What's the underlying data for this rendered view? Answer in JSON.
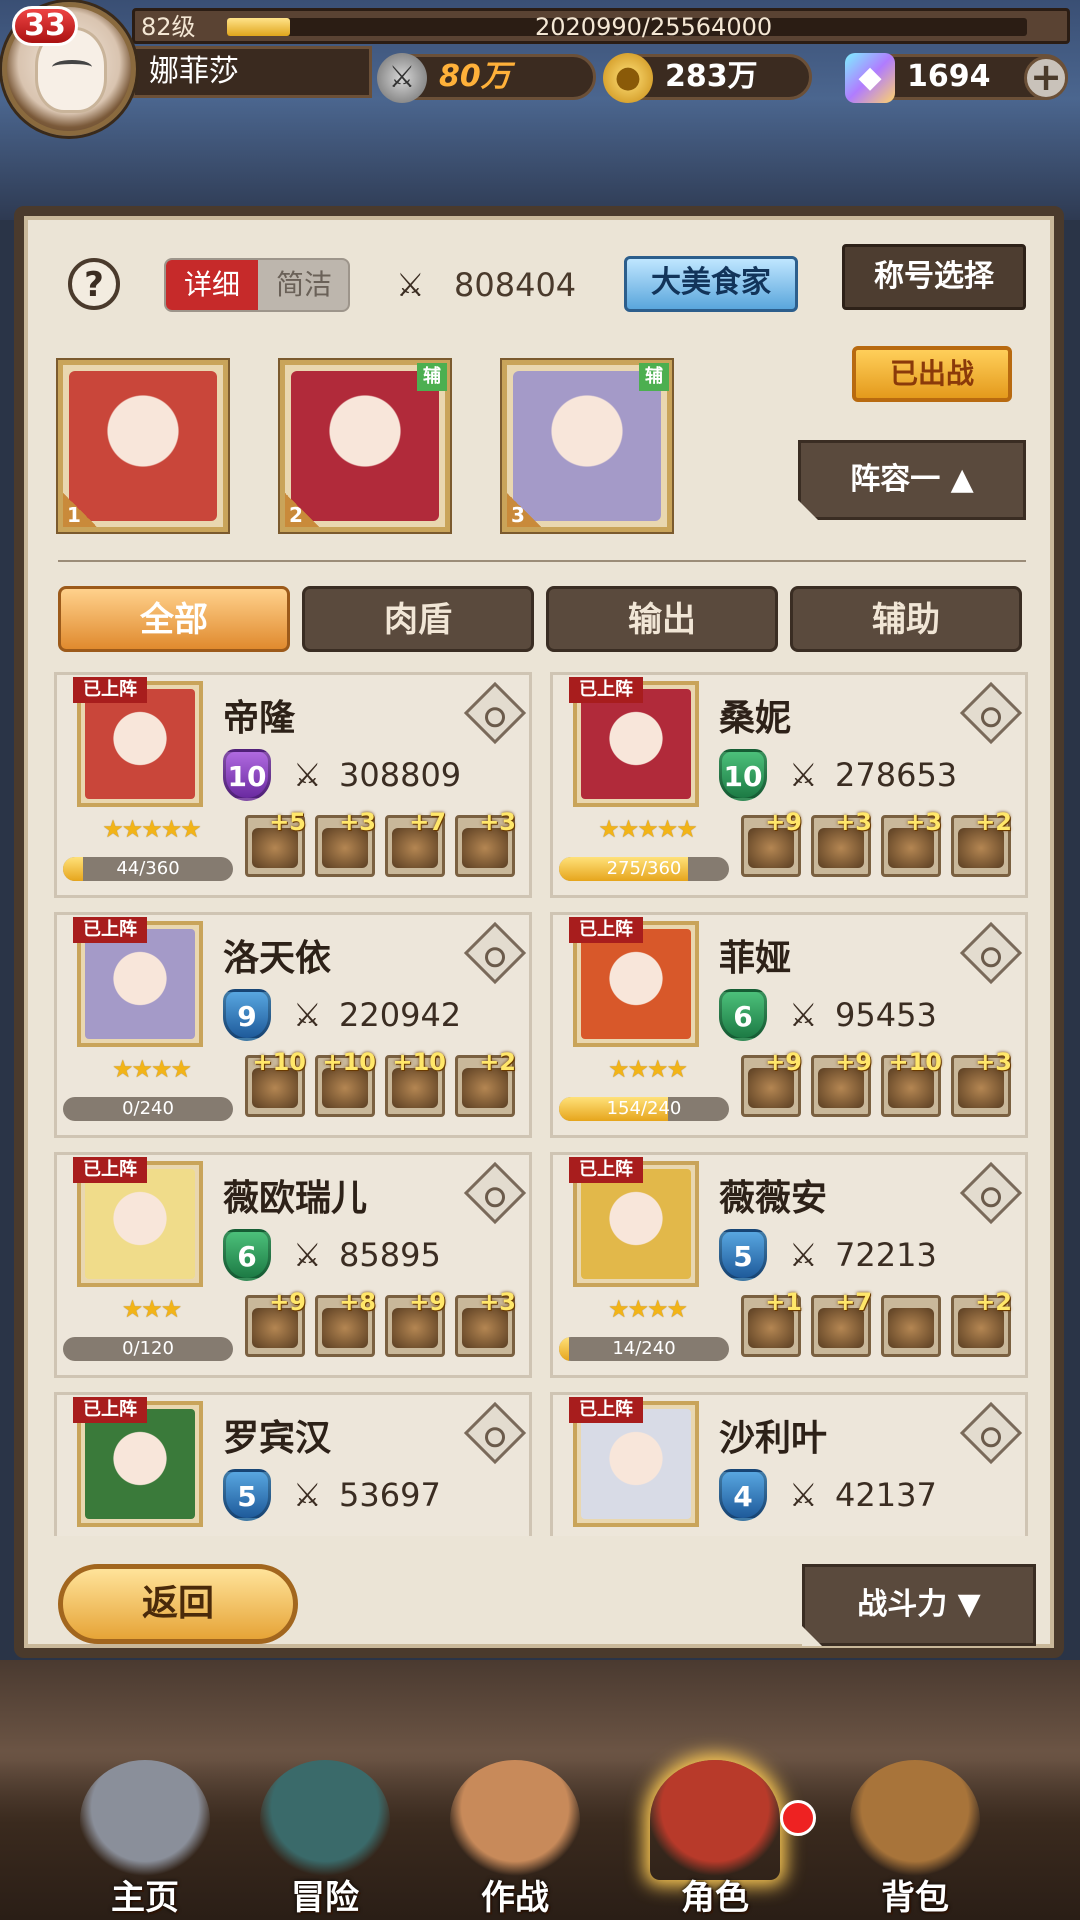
{
  "player": {
    "level_badge": "33",
    "level_text": "82级",
    "exp_text": "2020990/25564000",
    "exp_fraction": 0.079,
    "name": "娜菲莎",
    "power": "80万",
    "gold": "283万",
    "gems": "1694",
    "plus": "+"
  },
  "panel": {
    "help": "?",
    "mode_detail": "详细",
    "mode_simple": "简洁",
    "team_power": "808404",
    "title_badge": "大美食家",
    "title_select": "称号选择",
    "deployed": "已出战",
    "team_select": "阵容一 ▲",
    "sword_glyph": "⚔",
    "aux_label": "辅"
  },
  "team_slots": [
    {
      "num": "1",
      "aux": false,
      "color": "#c9463a"
    },
    {
      "num": "2",
      "aux": true,
      "color": "#b12a3a"
    },
    {
      "num": "3",
      "aux": true,
      "color": "#a49ac8"
    }
  ],
  "filters": [
    "全部",
    "肉盾",
    "输出",
    "辅助"
  ],
  "active_filter": 0,
  "heroes": [
    {
      "tag": "已上阵",
      "name": "帝隆",
      "rank": "10",
      "rank_color": "purple",
      "power": "308809",
      "stars": "★★★★★",
      "exp": "44/360",
      "exp_fraction": 0.12,
      "gear": [
        "+5",
        "+3",
        "+7",
        "+3"
      ],
      "color": "#c9463a"
    },
    {
      "tag": "已上阵",
      "name": "桑妮",
      "rank": "10",
      "rank_color": "green",
      "power": "278653",
      "stars": "★★★★★",
      "exp": "275/360",
      "exp_fraction": 0.76,
      "gear": [
        "+9",
        "+3",
        "+3",
        "+2"
      ],
      "color": "#b12a3a"
    },
    {
      "tag": "已上阵",
      "name": "洛天依",
      "rank": "9",
      "rank_color": "blue",
      "power": "220942",
      "stars": "★★★★",
      "exp": "0/240",
      "exp_fraction": 0,
      "gear": [
        "+10",
        "+10",
        "+10",
        "+2"
      ],
      "color": "#a49ac8"
    },
    {
      "tag": "已上阵",
      "name": "菲娅",
      "rank": "6",
      "rank_color": "green",
      "power": "95453",
      "stars": "★★★★",
      "exp": "154/240",
      "exp_fraction": 0.64,
      "gear": [
        "+9",
        "+9",
        "+10",
        "+3"
      ],
      "color": "#d8582a"
    },
    {
      "tag": "已上阵",
      "name": "薇欧瑞儿",
      "rank": "6",
      "rank_color": "green",
      "power": "85895",
      "stars": "★★★",
      "exp": "0/120",
      "exp_fraction": 0,
      "gear": [
        "+9",
        "+8",
        "+9",
        "+3"
      ],
      "color": "#f0dc8a"
    },
    {
      "tag": "已上阵",
      "name": "薇薇安",
      "rank": "5",
      "rank_color": "blue",
      "power": "72213",
      "stars": "★★★★",
      "exp": "14/240",
      "exp_fraction": 0.06,
      "gear": [
        "+1",
        "+7",
        "",
        "+2"
      ],
      "color": "#e2b84a"
    },
    {
      "tag": "已上阵",
      "name": "罗宾汉",
      "rank": "5",
      "rank_color": "blue",
      "power": "53697",
      "stars": "",
      "exp": "",
      "exp_fraction": 0,
      "gear": [],
      "color": "#3a7a3a"
    },
    {
      "tag": "已上阵",
      "name": "沙利叶",
      "rank": "4",
      "rank_color": "blue",
      "power": "42137",
      "stars": "",
      "exp": "",
      "exp_fraction": 0,
      "gear": [],
      "color": "#d8dbe6"
    }
  ],
  "footer": {
    "back": "返回",
    "sort": "战斗力 ▼"
  },
  "nav": [
    {
      "label": "主页",
      "icon": "castle-statue-icon",
      "color": "#8a8f9a"
    },
    {
      "label": "冒险",
      "icon": "portal-gate-icon",
      "color": "#3a6a6a"
    },
    {
      "label": "作战",
      "icon": "battle-girl-icon",
      "color": "#c88a5a"
    },
    {
      "label": "角色",
      "icon": "character-book-icon",
      "color": "#b83a2a"
    },
    {
      "label": "背包",
      "icon": "backpack-icon",
      "color": "#a8743a"
    }
  ],
  "active_nav": 3
}
